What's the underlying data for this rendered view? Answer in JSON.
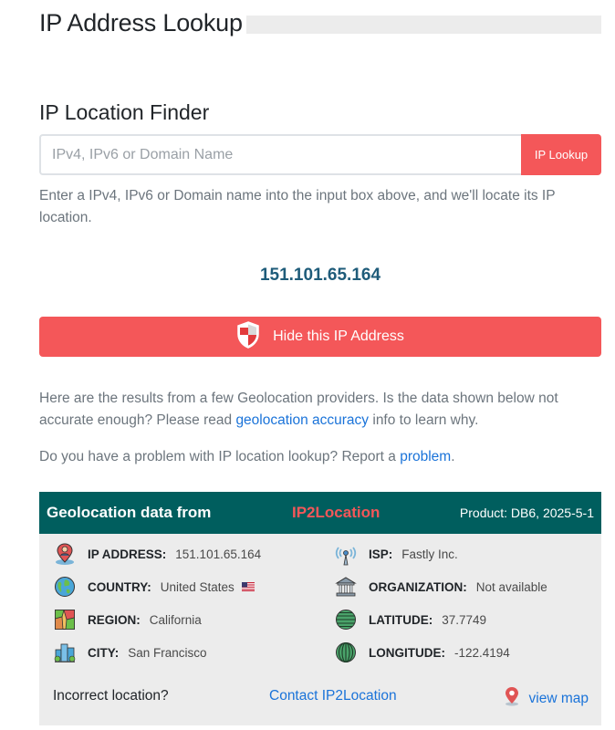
{
  "page": {
    "title": "IP Address Lookup",
    "section_title": "IP Location Finder"
  },
  "lookup": {
    "placeholder": "IPv4, IPv6 or Domain Name",
    "button_label": "IP Lookup",
    "help_text": "Enter a IPv4, IPv6 or Domain name into the input box above, and we'll locate its IP location."
  },
  "current_ip": "151.101.65.164",
  "hide_button": {
    "label": "Hide this IP Address",
    "icon": "shield-icon"
  },
  "results_note": {
    "before_link": "Here are the results from a few Geolocation providers. Is the data shown below not accurate enough? Please read ",
    "link_text": "geolocation accuracy",
    "after_link": " info to learn why."
  },
  "problem_note": {
    "before_link": "Do you have a problem with IP location lookup? Report a ",
    "link_text": "problem",
    "after_link": "."
  },
  "geo_card": {
    "header_label": "Geolocation data from",
    "provider": "IP2Location",
    "product": "Product: DB6, 2025-5-1",
    "colors": {
      "header_bg": "#005e5e",
      "accent": "#f45759"
    },
    "fields": {
      "ip_address": {
        "label": "IP ADDRESS:",
        "value": "151.101.65.164",
        "icon": "map-pin-person-icon"
      },
      "isp": {
        "label": "ISP:",
        "value": "Fastly Inc.",
        "icon": "antenna-icon"
      },
      "country": {
        "label": "COUNTRY:",
        "value": "United States",
        "icon": "globe-icon",
        "flag": "us-flag-icon"
      },
      "organization": {
        "label": "ORGANIZATION:",
        "value": "Not available",
        "icon": "building-icon"
      },
      "region": {
        "label": "REGION:",
        "value": "California",
        "icon": "region-map-icon"
      },
      "latitude": {
        "label": "LATITUDE:",
        "value": "37.7749",
        "icon": "latitude-globe-icon"
      },
      "city": {
        "label": "CITY:",
        "value": "San Francisco",
        "icon": "city-icon"
      },
      "longitude": {
        "label": "LONGITUDE:",
        "value": "-122.4194",
        "icon": "longitude-globe-icon"
      }
    },
    "footer": {
      "incorrect_label": "Incorrect location?",
      "contact_link": "Contact IP2Location",
      "view_map_link": "view map"
    }
  }
}
